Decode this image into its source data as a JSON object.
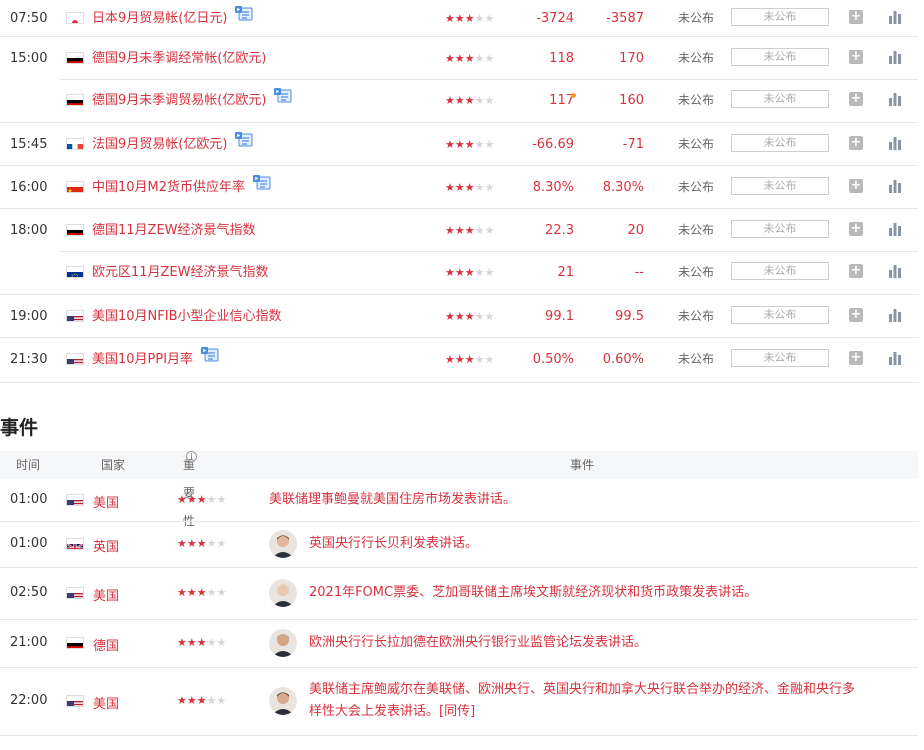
{
  "indicators": [
    {
      "time": "07:50",
      "flag": "jp",
      "name": "日本9月贸易帐(亿日元)",
      "info": true,
      "stars": 3,
      "prev": "-3724",
      "forecast": "-3587",
      "actual": "未公布",
      "actual_box": "未公布"
    },
    {
      "time": "15:00",
      "flag": "de",
      "name": "德国9月未季调经常帐(亿欧元)",
      "info": false,
      "stars": 3,
      "prev": "118",
      "forecast": "170",
      "actual": "未公布",
      "actual_box": "未公布"
    },
    {
      "time": "",
      "flag": "de",
      "name": "德国9月未季调贸易帐(亿欧元)",
      "info": true,
      "stars": 3,
      "prev": "117",
      "forecast": "160",
      "actual": "未公布",
      "actual_box": "未公布",
      "revised": true
    },
    {
      "time": "15:45",
      "flag": "fr",
      "name": "法国9月贸易帐(亿欧元)",
      "info": true,
      "stars": 3,
      "prev": "-66.69",
      "forecast": "-71",
      "actual": "未公布",
      "actual_box": "未公布"
    },
    {
      "time": "16:00",
      "flag": "cn",
      "name": "中国10月M2货币供应年率",
      "info": true,
      "stars": 3,
      "prev": "8.30%",
      "forecast": "8.30%",
      "actual": "未公布",
      "actual_box": "未公布"
    },
    {
      "time": "18:00",
      "flag": "de",
      "name": "德国11月ZEW经济景气指数",
      "info": false,
      "stars": 3,
      "prev": "22.3",
      "forecast": "20",
      "actual": "未公布",
      "actual_box": "未公布"
    },
    {
      "time": "",
      "flag": "eu",
      "name": "欧元区11月ZEW经济景气指数",
      "info": false,
      "stars": 3,
      "prev": "21",
      "forecast": "--",
      "actual": "未公布",
      "actual_box": "未公布"
    },
    {
      "time": "19:00",
      "flag": "us",
      "name": "美国10月NFIB小型企业信心指数",
      "info": false,
      "stars": 3,
      "prev": "99.1",
      "forecast": "99.5",
      "actual": "未公布",
      "actual_box": "未公布"
    },
    {
      "time": "21:30",
      "flag": "us",
      "name": "美国10月PPI月率",
      "info": true,
      "stars": 3,
      "prev": "0.50%",
      "forecast": "0.60%",
      "actual": "未公布",
      "actual_box": "未公布"
    }
  ],
  "events_section": {
    "title": "事件",
    "headers": {
      "time": "时间",
      "country": "国家",
      "importance": "重要性",
      "event": "事件"
    }
  },
  "events": [
    {
      "time": "01:00",
      "flag": "us",
      "country": "美国",
      "stars": 3,
      "avatar": false,
      "text": "美联储理事鲍曼就美国住房市场发表讲话。"
    },
    {
      "time": "01:00",
      "flag": "gb",
      "country": "英国",
      "stars": 3,
      "avatar": true,
      "text": "英国央行行长贝利发表讲话。"
    },
    {
      "time": "02:50",
      "flag": "us",
      "country": "美国",
      "stars": 3,
      "avatar": true,
      "text": "2021年FOMC票委、芝加哥联储主席埃文斯就经济现状和货币政策发表讲话。"
    },
    {
      "time": "21:00",
      "flag": "de",
      "country": "德国",
      "stars": 3,
      "avatar": true,
      "text": "欧洲央行行长拉加德在欧洲央行银行业监管论坛发表讲话。"
    },
    {
      "time": "22:00",
      "flag": "us",
      "country": "美国",
      "stars": 3,
      "avatar": true,
      "text_line1": "美联储主席鲍威尔在美联储、欧洲央行、英国央行和加拿大央行联合举办的经济、金融和央行多",
      "text_line2": "样性大会上发表讲话。[同传]"
    }
  ],
  "colors": {
    "accent": "#d8323f",
    "star_off": "#d5d5d5",
    "info_icon": "#4a8de0"
  }
}
